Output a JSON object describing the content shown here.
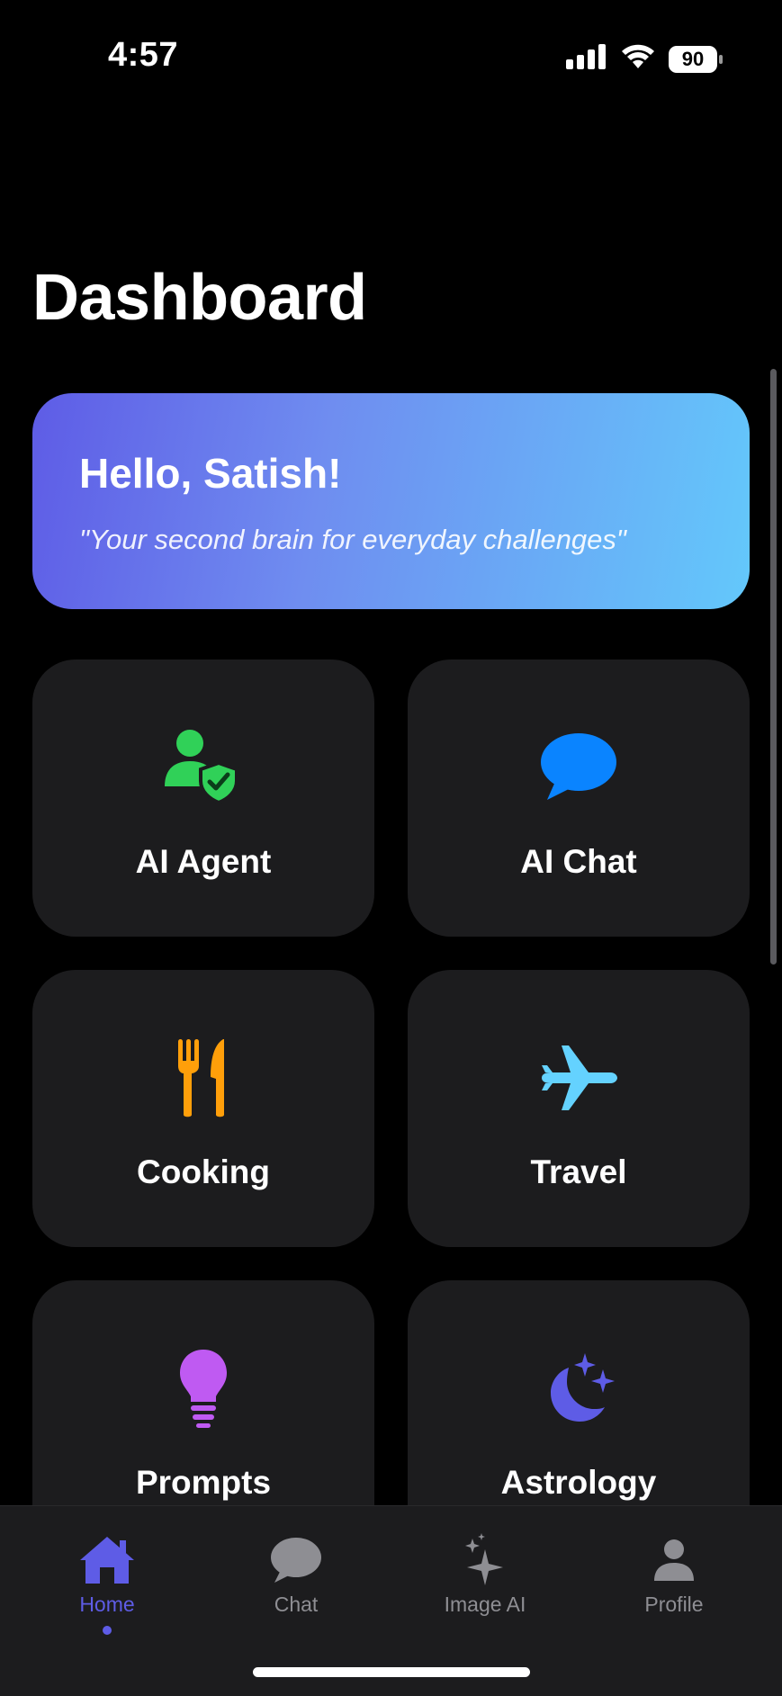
{
  "status_bar": {
    "time": "4:57",
    "battery": "90"
  },
  "page": {
    "title": "Dashboard"
  },
  "greeting": {
    "title": "Hello, Satish!",
    "quote": "\"Your second brain for everyday challenges\""
  },
  "features": [
    {
      "label": "AI Agent",
      "icon": "person-shield-icon",
      "color": "#30d158"
    },
    {
      "label": "AI Chat",
      "icon": "speech-bubble-icon",
      "color": "#0a84ff"
    },
    {
      "label": "Cooking",
      "icon": "fork-knife-icon",
      "color": "#ff9f0a"
    },
    {
      "label": "Travel",
      "icon": "airplane-icon",
      "color": "#64d2ff"
    },
    {
      "label": "Prompts",
      "icon": "lightbulb-icon",
      "color": "#bf5af2"
    },
    {
      "label": "Astrology",
      "icon": "moon-stars-icon",
      "color": "#5e5ce6"
    }
  ],
  "tab_bar": {
    "tabs": [
      {
        "label": "Home",
        "icon": "house-icon",
        "active": true
      },
      {
        "label": "Chat",
        "icon": "chat-bubble-icon",
        "active": false
      },
      {
        "label": "Image AI",
        "icon": "sparkles-icon",
        "active": false
      },
      {
        "label": "Profile",
        "icon": "person-icon",
        "active": false
      }
    ],
    "active_color": "#5e5ce6",
    "inactive_color": "#8e8e93"
  }
}
